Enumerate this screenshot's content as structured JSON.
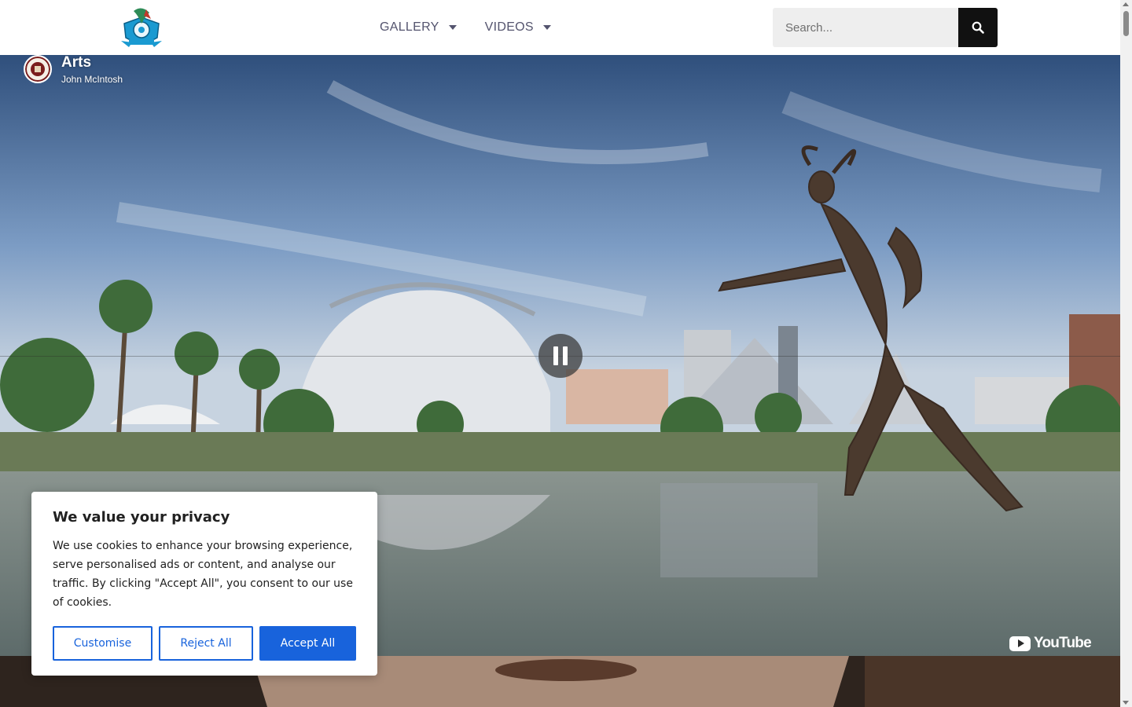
{
  "header": {
    "logo_alt": "site-logo",
    "nav": [
      {
        "label": "GALLERY"
      },
      {
        "label": "VIDEOS"
      }
    ],
    "search": {
      "placeholder": "Search..."
    }
  },
  "video": {
    "title": "Arts",
    "author": "John McIntosh",
    "provider": "YouTube",
    "state": "playing"
  },
  "cookie_banner": {
    "title": "We value your privacy",
    "body": "We use cookies to enhance your browsing experience, serve personalised ads or content, and analyse our traffic. By clicking \"Accept All\", you consent to our use of cookies.",
    "buttons": {
      "customise": "Customise",
      "reject": "Reject All",
      "accept": "Accept All"
    },
    "accent_color": "#1863dc"
  }
}
